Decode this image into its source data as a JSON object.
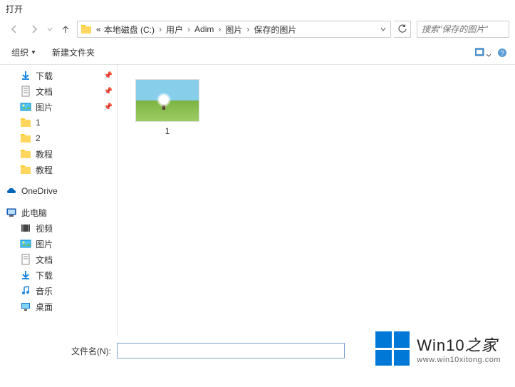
{
  "title": "打开",
  "breadcrumb": {
    "prefix": "«",
    "items": [
      "本地磁盘 (C:)",
      "用户",
      "Adim",
      "图片",
      "保存的图片"
    ]
  },
  "search": {
    "placeholder": "搜索\"保存的图片\""
  },
  "toolbar": {
    "organize": "组织",
    "newfolder": "新建文件夹"
  },
  "sidebar": {
    "items": [
      {
        "label": "下载",
        "icon": "download",
        "pin": true
      },
      {
        "label": "文档",
        "icon": "doc",
        "pin": true
      },
      {
        "label": "图片",
        "icon": "pic",
        "pin": true
      },
      {
        "label": "1",
        "icon": "folder"
      },
      {
        "label": "2",
        "icon": "folder"
      },
      {
        "label": "教程",
        "icon": "folder"
      },
      {
        "label": "教程",
        "icon": "folder"
      }
    ],
    "onedrive": "OneDrive",
    "thispc": "此电脑",
    "pc_items": [
      {
        "label": "视频",
        "icon": "video"
      },
      {
        "label": "图片",
        "icon": "pic"
      },
      {
        "label": "文档",
        "icon": "doc"
      },
      {
        "label": "下载",
        "icon": "download"
      },
      {
        "label": "音乐",
        "icon": "music"
      },
      {
        "label": "桌面",
        "icon": "desktop"
      }
    ]
  },
  "files": [
    {
      "name": "1"
    }
  ],
  "filename": {
    "label": "文件名(N):",
    "value": ""
  },
  "watermark": {
    "title_a": "Win10",
    "title_b": "之家",
    "url": "www.win10xitong.com"
  }
}
